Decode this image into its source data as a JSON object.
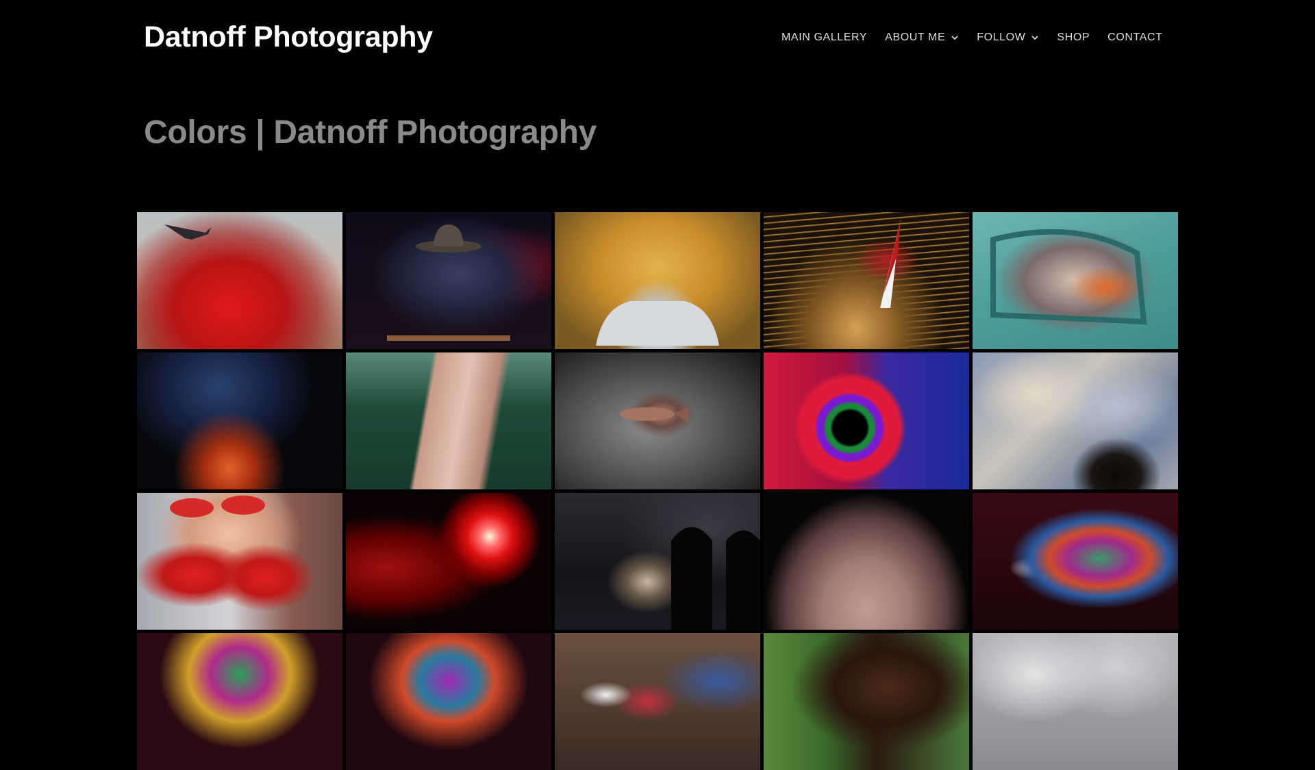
{
  "site": {
    "title": "Datnoff Photography"
  },
  "nav": {
    "items": [
      {
        "label": "MAIN GALLERY",
        "has_dropdown": false
      },
      {
        "label": "ABOUT ME",
        "has_dropdown": true
      },
      {
        "label": "FOLLOW",
        "has_dropdown": true
      },
      {
        "label": "SHOP",
        "has_dropdown": false
      },
      {
        "label": "CONTACT",
        "has_dropdown": false
      }
    ]
  },
  "page": {
    "title": "Colors | Datnoff Photography"
  },
  "colors": {
    "background": "#000000",
    "site_title": "#ffffff",
    "nav_text": "#dcdcdc",
    "page_title": "#8a8a8a"
  },
  "gallery": {
    "columns": 5,
    "tiles": [
      "red-smoke-air-tanker-photo",
      "man-with-hat-playing-instrument-photo",
      "white-convertible-orchard-photo",
      "windsurfer-golden-water-photo",
      "man-in-teal-car-photo",
      "blacksmith-hammering-hot-metal-photo",
      "redwood-trunk-forest-photo",
      "fish-on-gray-surface-photo",
      "rainbow-neon-tunnel-photo",
      "painted-faces-mural-photo",
      "two-boys-red-caps-photo",
      "red-light-burst-photo",
      "wine-barrels-cellar-photo",
      "water-drops-on-skin-photo",
      "man-with-giant-bubble-photo",
      "giant-bubble-photo-1",
      "giant-bubble-photo-2",
      "rodeo-cowboy-photo",
      "horse-in-field-photo",
      "cloudy-sky-photo"
    ]
  }
}
